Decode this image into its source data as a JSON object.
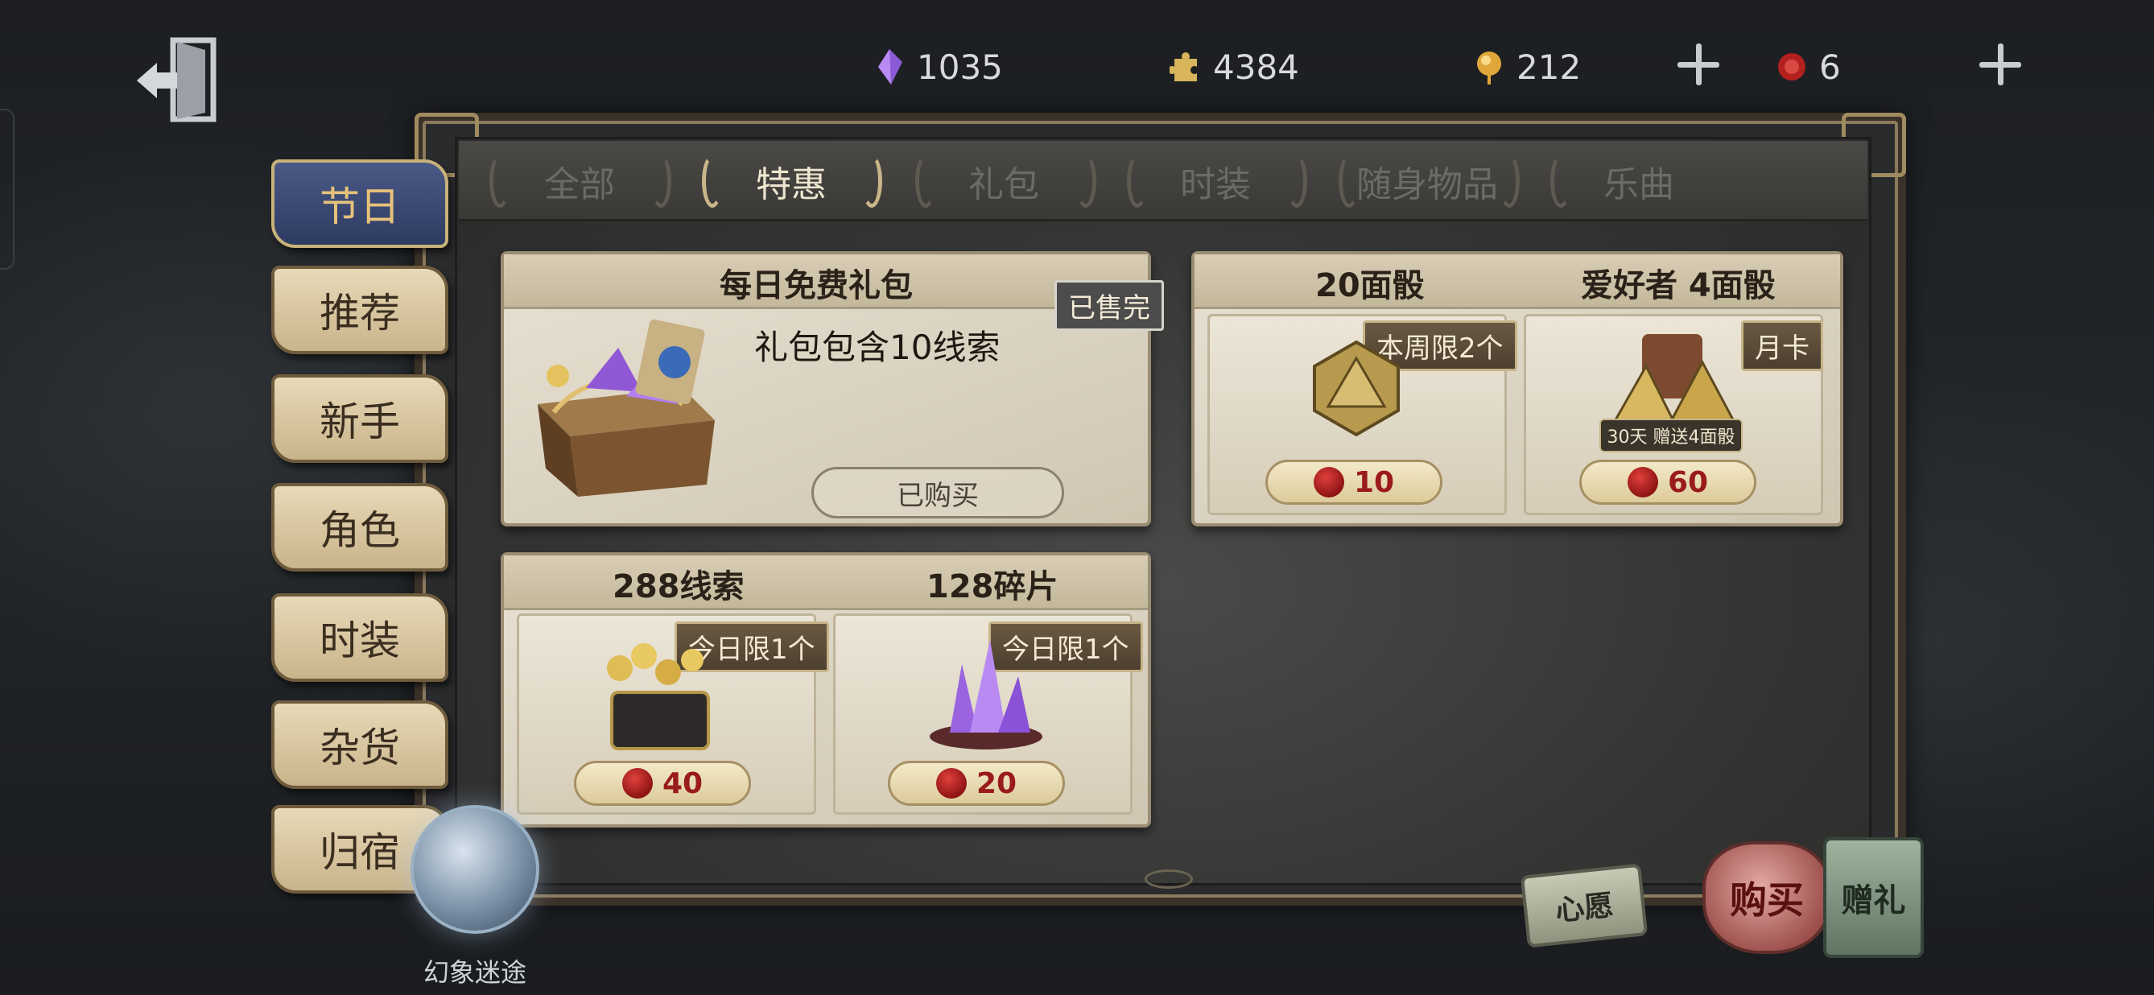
{
  "currencies": [
    {
      "icon": "purple-crystal-icon",
      "value": "1035"
    },
    {
      "icon": "gold-puzzle-piece-icon",
      "value": "4384"
    },
    {
      "icon": "gold-clue-orb-icon",
      "value": "212"
    },
    {
      "icon": "red-wax-seal-icon",
      "value": "6"
    }
  ],
  "tabs": [
    {
      "label": "全部",
      "active": false
    },
    {
      "label": "特惠",
      "active": true
    },
    {
      "label": "礼包",
      "active": false
    },
    {
      "label": "时装",
      "active": false
    },
    {
      "label": "随身物品",
      "active": false
    },
    {
      "label": "乐曲",
      "active": false
    }
  ],
  "sidebar": [
    {
      "label": "节日",
      "active": true
    },
    {
      "label": "推荐",
      "active": false
    },
    {
      "label": "新手",
      "active": false
    },
    {
      "label": "角色",
      "active": false
    },
    {
      "label": "时装",
      "active": false
    },
    {
      "label": "杂货",
      "active": false
    },
    {
      "label": "归宿",
      "active": false
    }
  ],
  "daily": {
    "title": "每日免费礼包",
    "status": "已售完",
    "description": "礼包包含10线索",
    "bought": "已购买"
  },
  "dice": {
    "title": "20面骰",
    "limit": "本周限2个",
    "price": "10"
  },
  "fan": {
    "title": "爱好者 4面骰",
    "tag": "月卡",
    "banner": "30天 赠送4面骰",
    "price": "60"
  },
  "clues": {
    "title": "288线索",
    "limit": "今日限1个",
    "price": "40"
  },
  "shards": {
    "title": "128碎片",
    "limit": "今日限1个",
    "price": "20"
  },
  "bottom": {
    "orb_label": "幻象迷途",
    "wish": "心愿",
    "buy": "购买",
    "gift": "赠礼"
  },
  "colors": {
    "price_red": "#9a1b1b",
    "active_tab": "#efe6d0",
    "active_side_bg": "#2e3b62"
  }
}
